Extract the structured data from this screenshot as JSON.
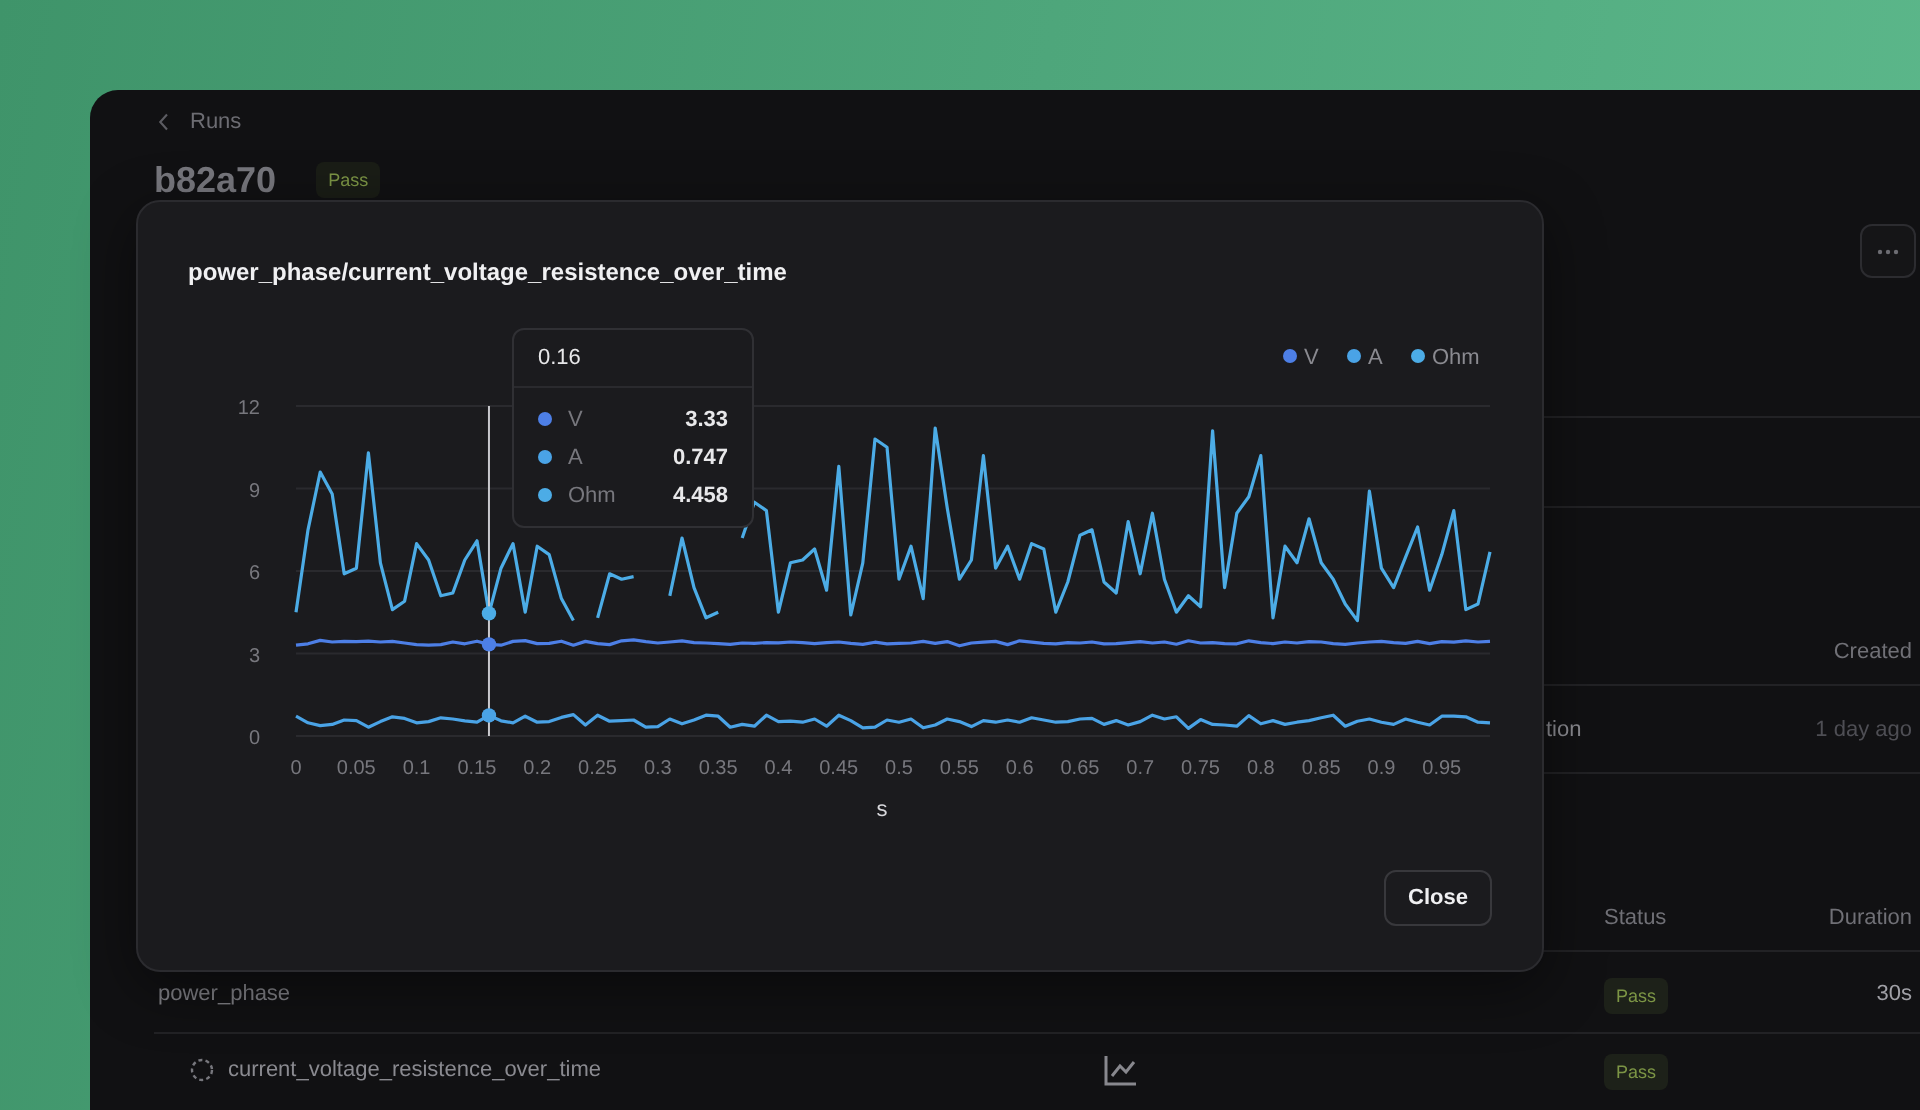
{
  "page": {
    "back_link": "Runs",
    "run_id": "b82a70",
    "status": "Pass",
    "summary_table": {
      "columns": [
        "Created"
      ],
      "rows": [
        {
          "name": "tion",
          "created": "1 day ago"
        }
      ]
    },
    "steps_table": {
      "columns": [
        "Status",
        "Duration"
      ],
      "rows": [
        {
          "kind": "phase",
          "name": "power_phase",
          "has_chart": false,
          "status": "Pass",
          "duration": "30s"
        },
        {
          "kind": "measurement",
          "name": "current_voltage_resistence_over_time",
          "has_chart": true,
          "status": "Pass",
          "duration": ""
        }
      ]
    }
  },
  "modal": {
    "title": "power_phase/current_voltage_resistence_over_time",
    "chart_data": {
      "type": "line",
      "xlabel": "s",
      "x": [
        0,
        0.01,
        0.02,
        0.03,
        0.04,
        0.05,
        0.06,
        0.07,
        0.08,
        0.09,
        0.1,
        0.11,
        0.12,
        0.13,
        0.14,
        0.15,
        0.16,
        0.17,
        0.18,
        0.19,
        0.2,
        0.21,
        0.22,
        0.23,
        0.24,
        0.25,
        0.26,
        0.27,
        0.28,
        0.29,
        0.3,
        0.31,
        0.32,
        0.33,
        0.34,
        0.35,
        0.36,
        0.37,
        0.38,
        0.39,
        0.4,
        0.41,
        0.42,
        0.43,
        0.44,
        0.45,
        0.46,
        0.47,
        0.48,
        0.49,
        0.5,
        0.51,
        0.52,
        0.53,
        0.54,
        0.55,
        0.56,
        0.57,
        0.58,
        0.59,
        0.6,
        0.61,
        0.62,
        0.63,
        0.64,
        0.65,
        0.66,
        0.67,
        0.68,
        0.69,
        0.7,
        0.71,
        0.72,
        0.73,
        0.74,
        0.75,
        0.76,
        0.77,
        0.78,
        0.79,
        0.8,
        0.81,
        0.82,
        0.83,
        0.84,
        0.85,
        0.86,
        0.87,
        0.88,
        0.89,
        0.9,
        0.91,
        0.92,
        0.93,
        0.94,
        0.95,
        0.96,
        0.97,
        0.98,
        0.99
      ],
      "series": [
        {
          "name": "V",
          "color": "#4d7fe6",
          "values": [
            3.3,
            3.35,
            3.48,
            3.42,
            3.44,
            3.43,
            3.45,
            3.42,
            3.44,
            3.38,
            3.32,
            3.3,
            3.32,
            3.42,
            3.35,
            3.45,
            3.33,
            3.3,
            3.44,
            3.47,
            3.36,
            3.37,
            3.45,
            3.3,
            3.44,
            3.36,
            3.32,
            3.46,
            3.5,
            3.43,
            3.38,
            3.42,
            3.46,
            3.4,
            3.38,
            3.36,
            3.33,
            3.38,
            3.37,
            3.4,
            3.39,
            3.42,
            3.4,
            3.36,
            3.4,
            3.42,
            3.37,
            3.33,
            3.41,
            3.35,
            3.37,
            3.38,
            3.44,
            3.37,
            3.43,
            3.28,
            3.38,
            3.41,
            3.44,
            3.32,
            3.46,
            3.41,
            3.37,
            3.35,
            3.4,
            3.38,
            3.42,
            3.35,
            3.36,
            3.4,
            3.43,
            3.38,
            3.42,
            3.34,
            3.46,
            3.38,
            3.4,
            3.36,
            3.35,
            3.46,
            3.4,
            3.36,
            3.42,
            3.38,
            3.43,
            3.42,
            3.36,
            3.33,
            3.38,
            3.42,
            3.44,
            3.4,
            3.37,
            3.44,
            3.36,
            3.43,
            3.41,
            3.46,
            3.42,
            3.44
          ]
        },
        {
          "name": "A",
          "color": "#4aa3e6",
          "values": [
            0.72,
            0.48,
            0.38,
            0.42,
            0.58,
            0.56,
            0.32,
            0.52,
            0.7,
            0.64,
            0.48,
            0.52,
            0.66,
            0.62,
            0.55,
            0.5,
            0.747,
            0.55,
            0.48,
            0.72,
            0.5,
            0.52,
            0.68,
            0.78,
            0.4,
            0.76,
            0.54,
            0.56,
            0.58,
            0.32,
            0.34,
            0.62,
            0.44,
            0.58,
            0.76,
            0.72,
            0.32,
            0.42,
            0.36,
            0.76,
            0.52,
            0.54,
            0.5,
            0.62,
            0.36,
            0.76,
            0.56,
            0.3,
            0.32,
            0.58,
            0.5,
            0.62,
            0.3,
            0.4,
            0.62,
            0.52,
            0.34,
            0.56,
            0.5,
            0.58,
            0.5,
            0.66,
            0.58,
            0.5,
            0.52,
            0.62,
            0.64,
            0.42,
            0.56,
            0.4,
            0.52,
            0.76,
            0.62,
            0.7,
            0.28,
            0.6,
            0.42,
            0.4,
            0.36,
            0.74,
            0.44,
            0.56,
            0.42,
            0.5,
            0.56,
            0.66,
            0.76,
            0.36,
            0.54,
            0.62,
            0.5,
            0.42,
            0.62,
            0.5,
            0.4,
            0.72,
            0.72,
            0.7,
            0.5,
            0.48
          ]
        },
        {
          "name": "Ohm",
          "color": "#4cace6",
          "values": [
            4.5,
            7.5,
            9.6,
            8.8,
            5.9,
            6.1,
            10.3,
            6.3,
            4.6,
            4.9,
            7.0,
            6.4,
            5.1,
            5.2,
            6.4,
            7.1,
            4.458,
            6.1,
            7.0,
            4.5,
            6.9,
            6.6,
            5.0,
            4.2,
            null,
            4.3,
            5.9,
            5.7,
            5.8,
            null,
            null,
            5.1,
            7.2,
            5.4,
            4.3,
            4.5,
            null,
            7.2,
            8.5,
            8.2,
            4.5,
            6.3,
            6.4,
            6.8,
            5.3,
            9.8,
            4.4,
            6.3,
            10.8,
            10.5,
            5.7,
            6.9,
            5.0,
            11.2,
            8.3,
            5.7,
            6.4,
            10.2,
            6.1,
            6.9,
            5.7,
            7.0,
            6.8,
            4.5,
            5.6,
            7.3,
            7.5,
            5.6,
            5.2,
            7.8,
            5.9,
            8.1,
            5.7,
            4.5,
            5.1,
            4.7,
            11.1,
            5.4,
            8.1,
            8.7,
            10.2,
            4.3,
            6.9,
            6.3,
            7.9,
            6.3,
            5.7,
            4.8,
            4.2,
            8.9,
            6.1,
            5.4,
            6.5,
            7.6,
            5.3,
            6.6,
            8.2,
            4.6,
            4.8,
            6.7
          ]
        }
      ],
      "xlim": [
        0,
        0.99
      ],
      "ylim": [
        0,
        12
      ],
      "xticks": [
        0,
        0.05,
        0.1,
        0.15,
        0.2,
        0.25,
        0.3,
        0.35,
        0.4,
        0.45,
        0.5,
        0.55,
        0.6,
        0.65,
        0.7,
        0.75,
        0.8,
        0.85,
        0.9,
        0.95
      ],
      "yticks": [
        0,
        3,
        6,
        9,
        12
      ],
      "grid": true,
      "legend": true,
      "ref_lines": [
        {
          "axis": "x",
          "value": 0.16
        }
      ]
    },
    "tooltip": {
      "title": "0.16",
      "rows": [
        {
          "name": "V",
          "value": "3.33"
        },
        {
          "name": "A",
          "value": "0.747"
        },
        {
          "name": "Ohm",
          "value": "4.458"
        }
      ]
    },
    "close_button": "Close"
  }
}
